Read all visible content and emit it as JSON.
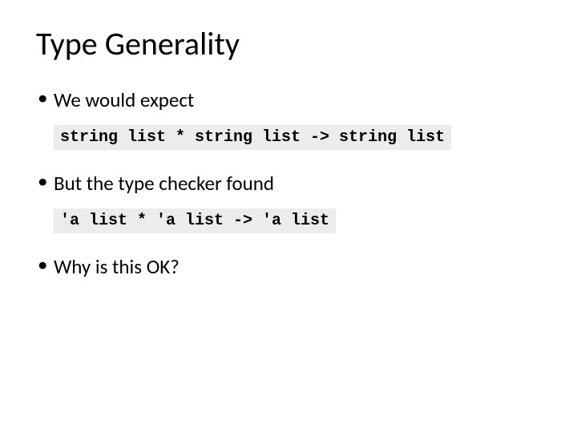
{
  "title": "Type Generality",
  "bullets": {
    "b1": "We would expect",
    "b2": "But the type checker found",
    "b3": "Why is this OK?"
  },
  "code": {
    "c1": "string list * string list -> string list",
    "c2": "'a list * 'a list -> 'a list"
  }
}
